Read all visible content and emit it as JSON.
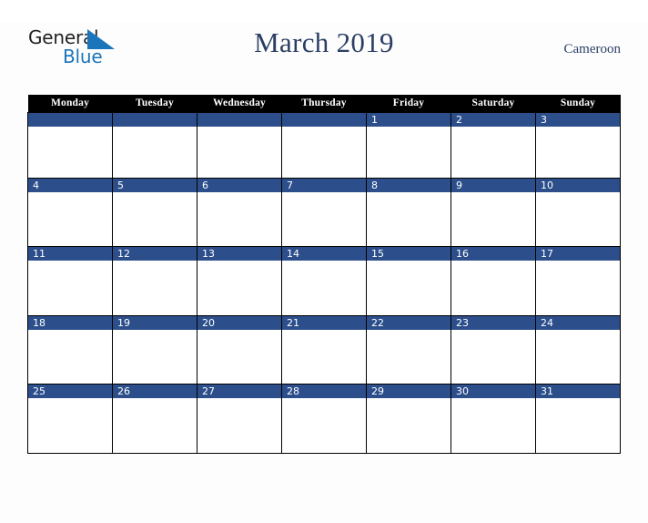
{
  "brand": {
    "name_top": "General",
    "name_bottom": "Blue",
    "color_dark": "#231f20",
    "color_blue": "#1b75bb"
  },
  "header": {
    "month_title": "March 2019",
    "country": "Cameroon",
    "title_color": "#2b3f66"
  },
  "theme": {
    "header_bar": "#000000",
    "day_strip": "#2c4f8c",
    "cell_bg": "#ffffff",
    "page_bg": "#fdfdfd",
    "grid_line": "#000000"
  },
  "calendar": {
    "weekday_headers": [
      "Monday",
      "Tuesday",
      "Wednesday",
      "Thursday",
      "Friday",
      "Saturday",
      "Sunday"
    ],
    "weeks": [
      [
        "",
        "",
        "",
        "",
        "1",
        "2",
        "3"
      ],
      [
        "4",
        "5",
        "6",
        "7",
        "8",
        "9",
        "10"
      ],
      [
        "11",
        "12",
        "13",
        "14",
        "15",
        "16",
        "17"
      ],
      [
        "18",
        "19",
        "20",
        "21",
        "22",
        "23",
        "24"
      ],
      [
        "25",
        "26",
        "27",
        "28",
        "29",
        "30",
        "31"
      ]
    ]
  }
}
